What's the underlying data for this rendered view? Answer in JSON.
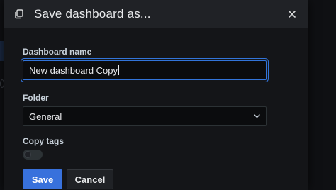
{
  "modal": {
    "title": "Save dashboard as...",
    "header_icon": "copy-icon",
    "close_icon": "close-icon"
  },
  "form": {
    "dashboard_name": {
      "label": "Dashboard name",
      "value": "New dashboard Copy"
    },
    "folder": {
      "label": "Folder",
      "selected": "General"
    },
    "copy_tags": {
      "label": "Copy tags",
      "checked": false
    }
  },
  "actions": {
    "save": "Save",
    "cancel": "Cancel"
  },
  "colors": {
    "accent": "#3274d9",
    "primary_button": "#3871dc",
    "background": "#141518",
    "header": "#202226"
  }
}
